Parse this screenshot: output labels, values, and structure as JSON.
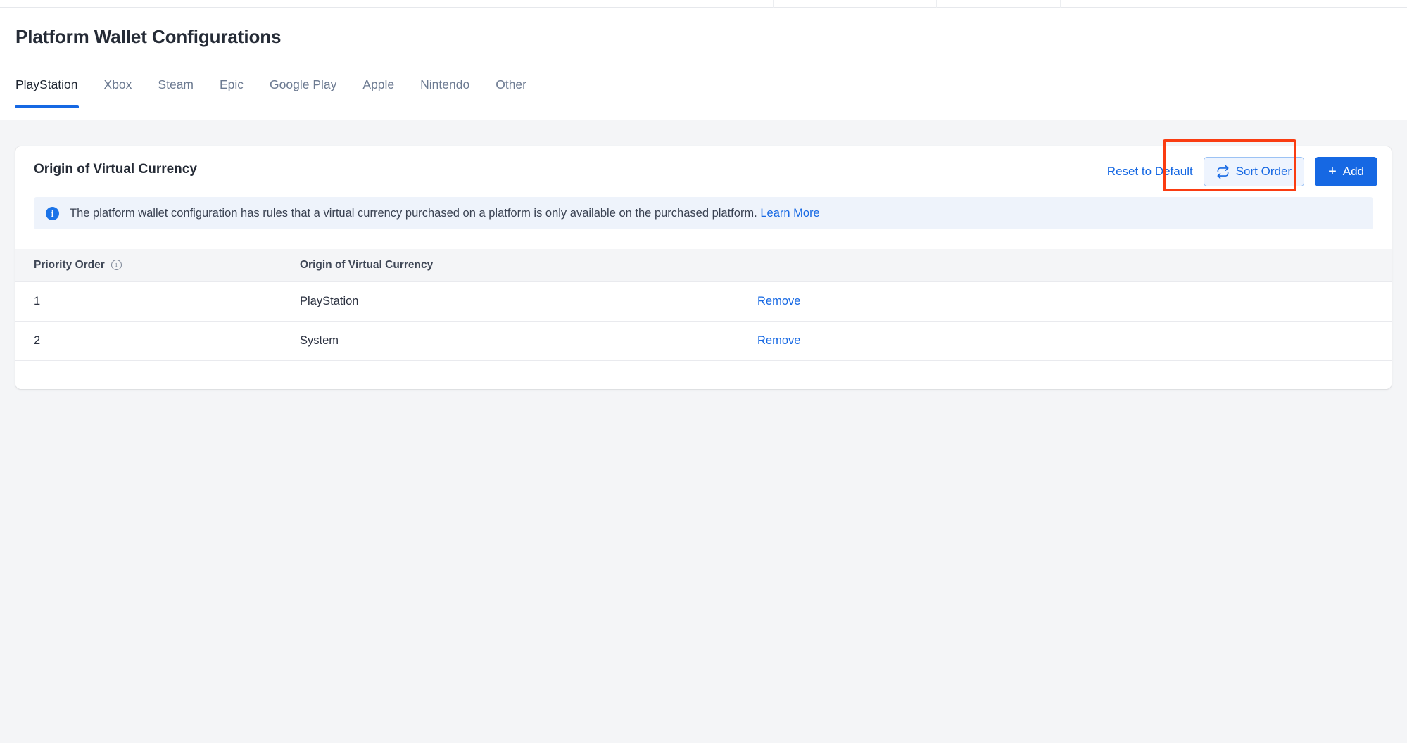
{
  "page": {
    "title": "Platform Wallet Configurations",
    "background_color": "#f4f5f7",
    "accent_color": "#1668e3",
    "annotation_color": "#fa3c11"
  },
  "tabs": [
    {
      "label": "PlayStation",
      "active": true
    },
    {
      "label": "Xbox",
      "active": false
    },
    {
      "label": "Steam",
      "active": false
    },
    {
      "label": "Epic",
      "active": false
    },
    {
      "label": "Google Play",
      "active": false
    },
    {
      "label": "Apple",
      "active": false
    },
    {
      "label": "Nintendo",
      "active": false
    },
    {
      "label": "Other",
      "active": false
    }
  ],
  "card": {
    "title": "Origin of Virtual Currency",
    "actions": {
      "reset_label": "Reset to Default",
      "sort_order_label": "Sort Order",
      "sort_order_icon": "swap-arrows-icon",
      "add_label": "Add",
      "add_icon": "plus-icon"
    },
    "banner": {
      "icon": "info-circle-icon",
      "icon_glyph": "i",
      "text": "The platform wallet configuration has rules that a virtual currency purchased on a platform is only available on the purchased platform.",
      "link_label": "Learn More"
    },
    "table": {
      "columns": [
        {
          "label": "Priority Order",
          "icon": "help-circle-icon",
          "icon_glyph": "i"
        },
        {
          "label": "Origin of Virtual Currency"
        },
        {
          "label": ""
        }
      ],
      "rows": [
        {
          "priority": "1",
          "origin": "PlayStation",
          "action": "Remove"
        },
        {
          "priority": "2",
          "origin": "System",
          "action": "Remove"
        }
      ]
    }
  }
}
